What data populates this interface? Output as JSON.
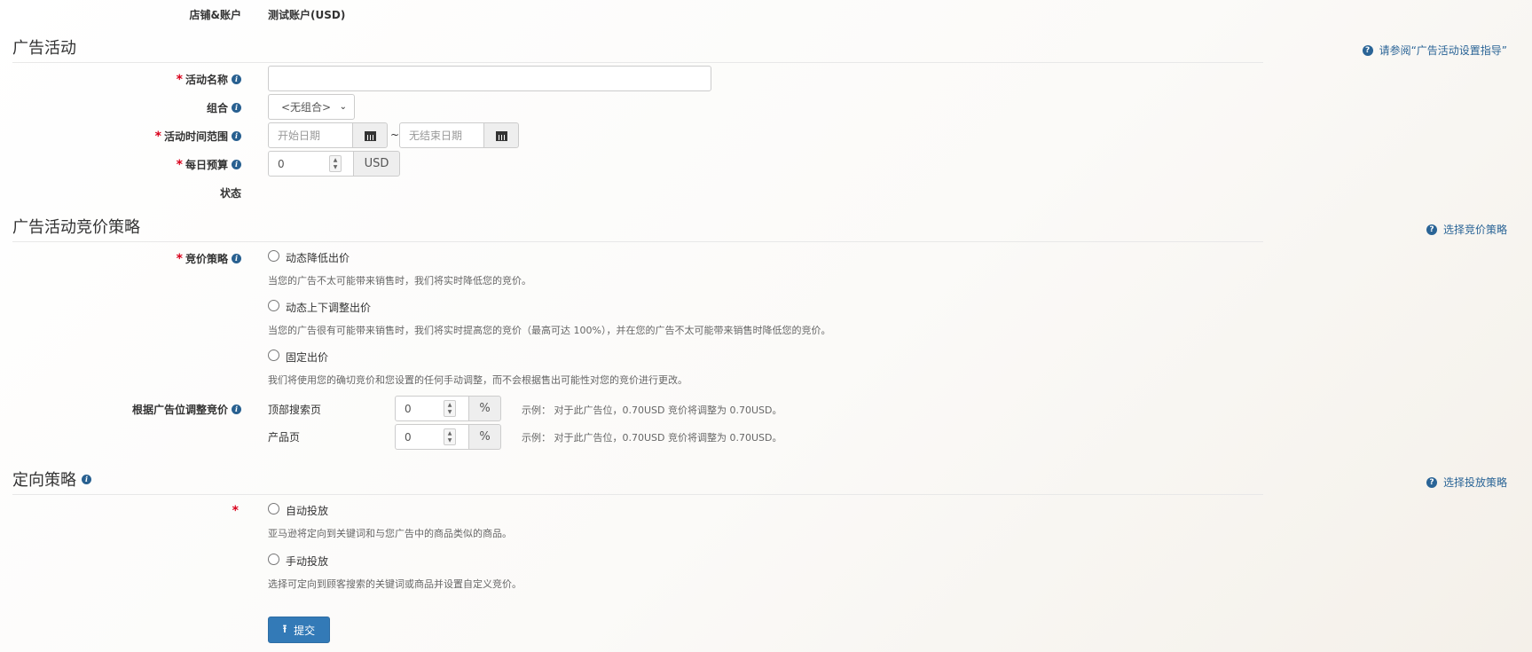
{
  "store_account": {
    "label": "店铺&账户",
    "value": "测试账户(USD)"
  },
  "campaign": {
    "title": "广告活动",
    "help": "请参阅“广告活动设置指导”",
    "name_label": "活动名称",
    "name_value": "",
    "portfolio_label": "组合",
    "portfolio_value": "<无组合>",
    "date_label": "活动时间范围",
    "start_placeholder": "开始日期",
    "date_sep": "~",
    "end_placeholder": "无结束日期",
    "budget_label": "每日预算",
    "budget_value": "0",
    "budget_unit": "USD",
    "status_label": "状态"
  },
  "bidding": {
    "title": "广告活动竞价策略",
    "help": "选择竞价策略",
    "strategy_label": "竞价策略",
    "options": [
      {
        "label": "动态降低出价",
        "desc": "当您的广告不太可能带来销售时，我们将实时降低您的竞价。"
      },
      {
        "label": "动态上下调整出价",
        "desc": "当您的广告很有可能带来销售时，我们将实时提高您的竞价（最高可达 100%），并在您的广告不太可能带来销售时降低您的竞价。"
      },
      {
        "label": "固定出价",
        "desc": "我们将使用您的确切竞价和您设置的任何手动调整，而不会根据售出可能性对您的竞价进行更改。"
      }
    ],
    "placement_label": "根据广告位调整竞价",
    "placements": [
      {
        "name": "顶部搜索页",
        "value": "0",
        "unit": "%",
        "example": "示例：  对于此广告位，0.70USD 竞价将调整为 0.70USD。"
      },
      {
        "name": "产品页",
        "value": "0",
        "unit": "%",
        "example": "示例：  对于此广告位，0.70USD 竞价将调整为 0.70USD。"
      }
    ]
  },
  "targeting": {
    "title": "定向策略",
    "help": "选择投放策略",
    "options": [
      {
        "label": "自动投放",
        "desc": "亚马逊将定向到关键词和与您广告中的商品类似的商品。"
      },
      {
        "label": "手动投放",
        "desc": "选择可定向到顾客搜索的关键词或商品并设置自定义竞价。"
      }
    ]
  },
  "submit_label": "提交",
  "colors": {
    "primary": "#337ab7",
    "link": "#2a6496",
    "required": "#d9001b"
  }
}
